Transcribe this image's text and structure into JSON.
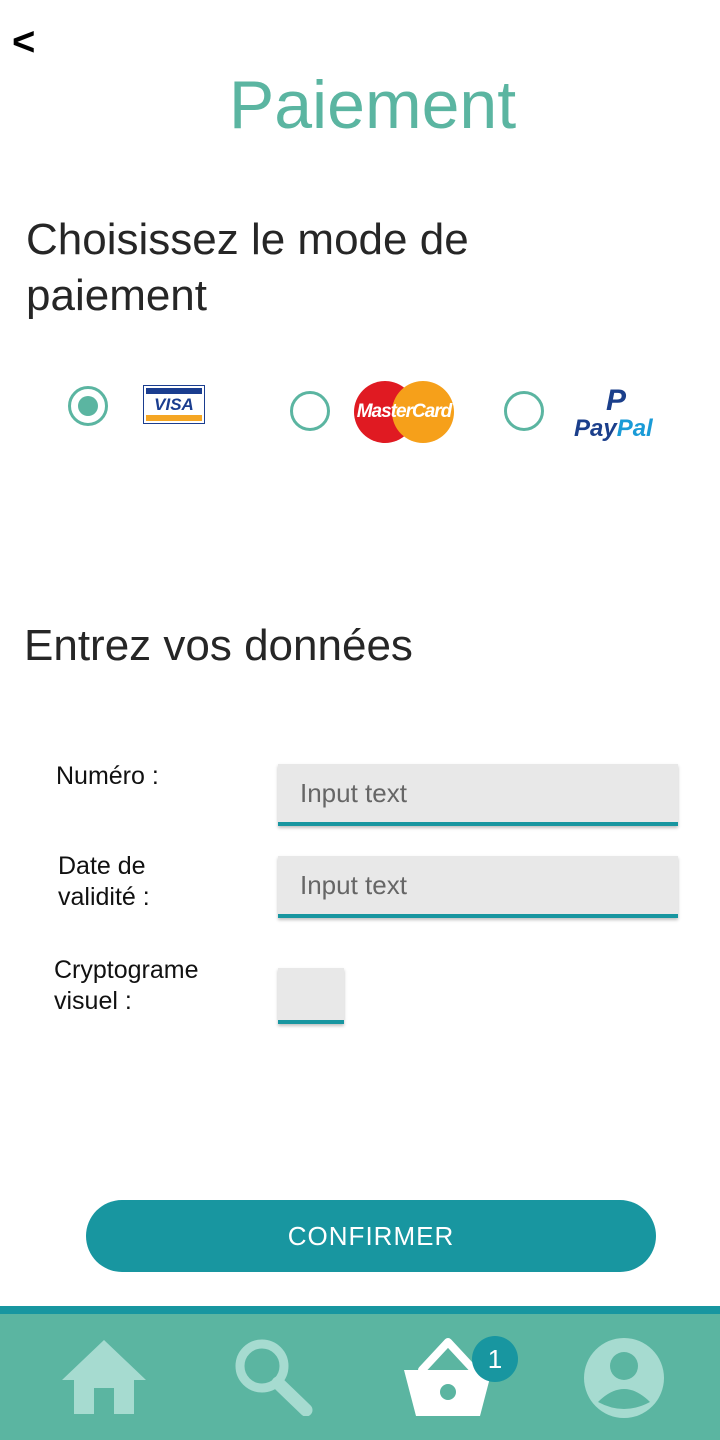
{
  "header": {
    "back_label": "<",
    "title": "Paiement"
  },
  "payment_method": {
    "heading": "Choisissez le mode de paiement",
    "options": [
      {
        "label": "VISA",
        "selected": true
      },
      {
        "label": "MasterCard",
        "selected": false
      },
      {
        "label_pay": "Pay",
        "label_pal": "Pal",
        "label_p": "P",
        "selected": false
      }
    ]
  },
  "form": {
    "heading": "Entrez vos données",
    "number_label": "Numéro :",
    "number_placeholder": "Input text",
    "date_label_1": "Date de",
    "date_label_2": "validité :",
    "date_placeholder": "Input text",
    "cvv_label_1": "Cryptograme",
    "cvv_label_2": "visuel :"
  },
  "confirm_label": "CONFIRMER",
  "bottom_nav": {
    "items": [
      "home-icon",
      "search-icon",
      "basket-icon",
      "profile-icon"
    ],
    "basket_badge": "1"
  },
  "colors": {
    "accent": "#5bb5a1",
    "primary": "#1896a0",
    "nav_icon": "#a6dbd0"
  }
}
